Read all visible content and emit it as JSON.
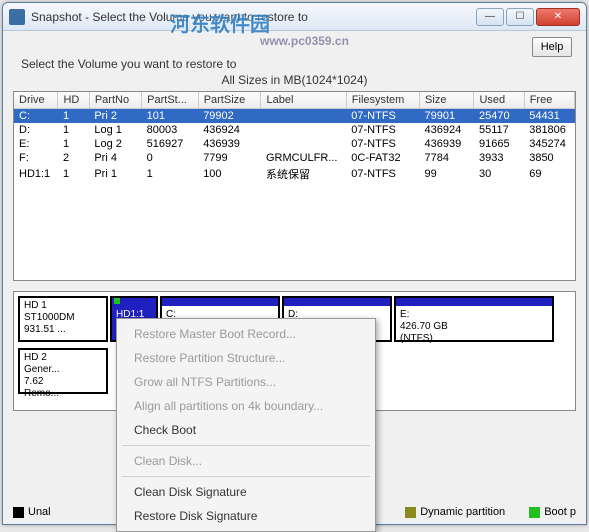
{
  "window": {
    "title": "Snapshot - Select the Volume you want to restore to",
    "min_glyph": "—",
    "max_glyph": "☐",
    "close_glyph": "✕"
  },
  "help_label": "Help",
  "subtitle": "Select the Volume you want to restore to",
  "sizes_note": "All Sizes in MB(1024*1024)",
  "watermark_main": "河东软件园",
  "watermark_url": "www.pc0359.cn",
  "columns": [
    "Drive",
    "HD",
    "PartNo",
    "PartSt...",
    "PartSize",
    "Label",
    "Filesystem",
    "Size",
    "Used",
    "Free"
  ],
  "rows": [
    {
      "sel": true,
      "cells": [
        "C:",
        "1",
        "Pri 2",
        "101",
        "79902",
        "",
        "07-NTFS",
        "79901",
        "25470",
        "54431"
      ]
    },
    {
      "sel": false,
      "cells": [
        "D:",
        "1",
        "Log 1",
        "80003",
        "436924",
        "",
        "07-NTFS",
        "436924",
        "55117",
        "381806"
      ]
    },
    {
      "sel": false,
      "cells": [
        "E:",
        "1",
        "Log 2",
        "516927",
        "436939",
        "",
        "07-NTFS",
        "436939",
        "91665",
        "345274"
      ]
    },
    {
      "sel": false,
      "cells": [
        "F:",
        "2",
        "Pri 4",
        "0",
        "7799",
        "GRMCULFR...",
        "0C-FAT32",
        "7784",
        "3933",
        "3850"
      ]
    },
    {
      "sel": false,
      "cells": [
        "HD1:1",
        "1",
        "Pri 1",
        "1",
        "100",
        "系统保留",
        "07-NTFS",
        "99",
        "30",
        "69"
      ]
    }
  ],
  "disk1": {
    "hdr_line1": "HD 1",
    "hdr_line2": "ST1000DM",
    "hdr_line3": "931.51 ...",
    "hd11": "HD1:1",
    "c_label": "C:",
    "d_label": "D:",
    "e_label": "E:",
    "e_size": "426.70 GB",
    "e_fs": "(NTFS)"
  },
  "disk2": {
    "hdr_line1": "HD 2",
    "hdr_line2": "Gener...",
    "hdr_line3": "7.62",
    "hdr_line4": "Remo..."
  },
  "legend": {
    "unal": "Unal",
    "dyn": "Dynamic partition",
    "boot": "Boot p"
  },
  "context_menu": [
    {
      "label": "Restore Master Boot Record...",
      "enabled": false
    },
    {
      "label": "Restore Partition Structure...",
      "enabled": false
    },
    {
      "label": "Grow all NTFS Partitions...",
      "enabled": false
    },
    {
      "label": "Align all partitions on 4k boundary...",
      "enabled": false
    },
    {
      "label": "Check Boot",
      "enabled": true
    },
    {
      "sep": true
    },
    {
      "label": "Clean Disk...",
      "enabled": false
    },
    {
      "sep": true
    },
    {
      "label": "Clean Disk Signature",
      "enabled": true
    },
    {
      "label": "Restore Disk Signature",
      "enabled": true
    }
  ]
}
